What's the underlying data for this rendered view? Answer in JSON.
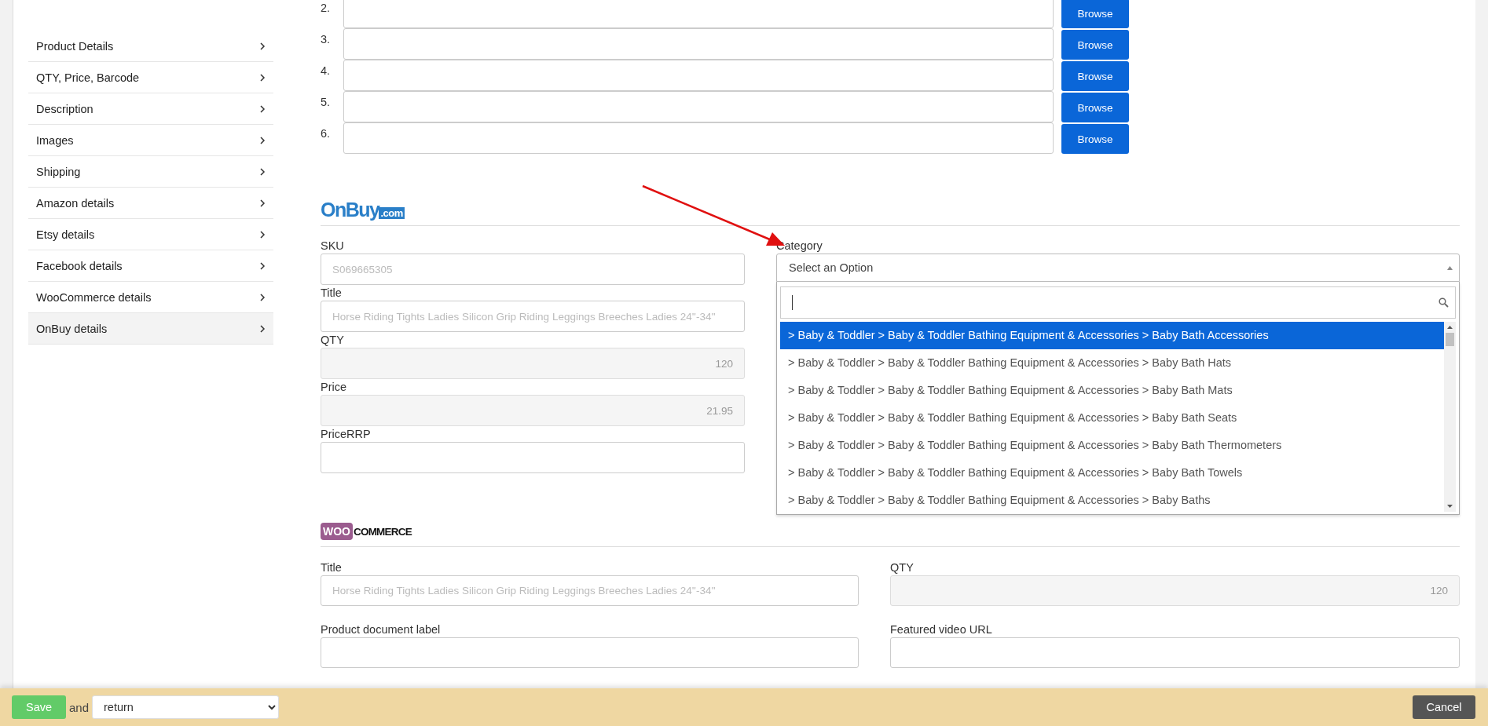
{
  "sidebar": {
    "items": [
      {
        "label": "Product Details",
        "selected": false
      },
      {
        "label": "QTY, Price, Barcode",
        "selected": false
      },
      {
        "label": "Description",
        "selected": false
      },
      {
        "label": "Images",
        "selected": false
      },
      {
        "label": "Shipping",
        "selected": false
      },
      {
        "label": "Amazon details",
        "selected": false
      },
      {
        "label": "Etsy details",
        "selected": false
      },
      {
        "label": "Facebook details",
        "selected": false
      },
      {
        "label": "WooCommerce details",
        "selected": false
      },
      {
        "label": "OnBuy details",
        "selected": true
      }
    ]
  },
  "image_rows": [
    {
      "number": "2.",
      "button": "Browse"
    },
    {
      "number": "3.",
      "button": "Browse"
    },
    {
      "number": "4.",
      "button": "Browse"
    },
    {
      "number": "5.",
      "button": "Browse"
    },
    {
      "number": "6.",
      "button": "Browse"
    }
  ],
  "onbuy": {
    "logo": {
      "name": "OnBuy",
      "suffix": ".com"
    },
    "fields": [
      {
        "label": "SKU",
        "placeholder": "S069665305",
        "disabled": false
      },
      {
        "label": "Title",
        "placeholder": "Horse Riding Tights Ladies Silicon Grip Riding Leggings Breeches Ladies 24''-34''",
        "disabled": false
      },
      {
        "label": "QTY",
        "value": "120",
        "disabled": true
      },
      {
        "label": "Price",
        "value": "21.95",
        "disabled": true
      },
      {
        "label": "PriceRRP",
        "disabled": false
      }
    ],
    "category": {
      "label": "Category",
      "placeholder": "Select an Option",
      "expanded": true,
      "options": [
        {
          "label": "> Baby & Toddler > Baby & Toddler Bathing Equipment & Accessories > Baby Bath Accessories",
          "selected": true
        },
        {
          "label": "> Baby & Toddler > Baby & Toddler Bathing Equipment & Accessories > Baby Bath Hats",
          "selected": false
        },
        {
          "label": "> Baby & Toddler > Baby & Toddler Bathing Equipment & Accessories > Baby Bath Mats",
          "selected": false
        },
        {
          "label": "> Baby & Toddler > Baby & Toddler Bathing Equipment & Accessories > Baby Bath Seats",
          "selected": false
        },
        {
          "label": "> Baby & Toddler > Baby & Toddler Bathing Equipment & Accessories > Baby Bath Thermometers",
          "selected": false
        },
        {
          "label": "> Baby & Toddler > Baby & Toddler Bathing Equipment & Accessories > Baby Bath Towels",
          "selected": false
        },
        {
          "label": "> Baby & Toddler > Baby & Toddler Bathing Equipment & Accessories > Baby Baths",
          "selected": false
        }
      ]
    }
  },
  "woocommerce": {
    "logo": {
      "badge": "WOO",
      "name": "COMMERCE"
    },
    "fields": [
      {
        "label": "Title",
        "placeholder": "Horse Riding Tights Ladies Silicon Grip Riding Leggings Breeches Ladies 24''-34''",
        "disabled": false
      },
      {
        "label": "QTY",
        "value": "120",
        "disabled": true
      },
      {
        "label": "Product document label",
        "disabled": false
      },
      {
        "label": "Featured video URL",
        "disabled": false
      }
    ]
  },
  "bottom_bar": {
    "save": "Save",
    "joiner": "and",
    "action": "return",
    "cancel": "Cancel"
  }
}
